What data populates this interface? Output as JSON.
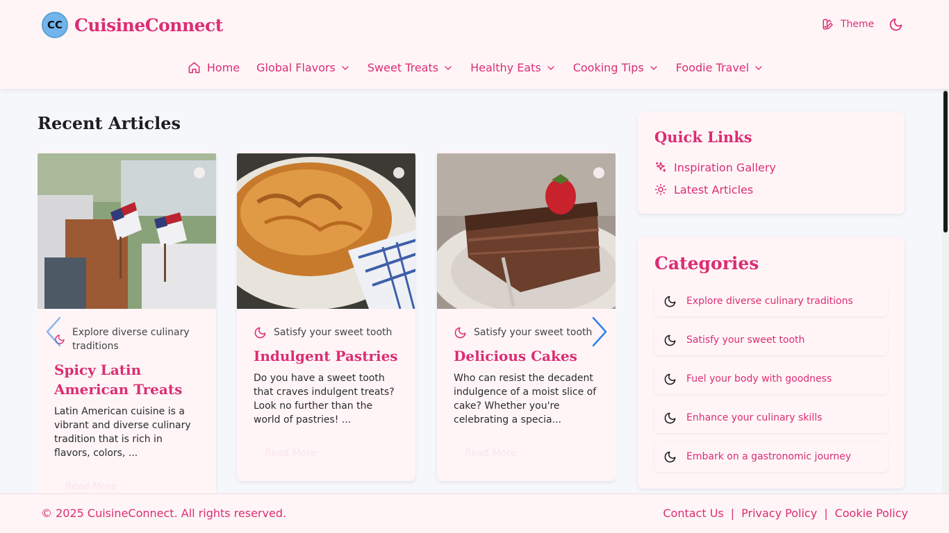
{
  "brand": {
    "initials": "CC",
    "name": "CuisineConnect"
  },
  "header": {
    "theme_label": "Theme",
    "icons": {
      "theme": "palette-icon",
      "mode": "moon-icon"
    }
  },
  "nav": [
    {
      "label": "Home",
      "icon": "home-icon"
    },
    {
      "label": "Global Flavors",
      "icon": "chevron-down-icon"
    },
    {
      "label": "Sweet Treats",
      "icon": "chevron-down-icon"
    },
    {
      "label": "Healthy Eats",
      "icon": "chevron-down-icon"
    },
    {
      "label": "Cooking Tips",
      "icon": "chevron-down-icon"
    },
    {
      "label": "Foodie Travel",
      "icon": "chevron-down-icon"
    }
  ],
  "recent": {
    "title": "Recent Articles",
    "articles": [
      {
        "category": "Explore diverse culinary traditions",
        "title": "Spicy Latin American Treats",
        "excerpt": "Latin American cuisine is a vibrant and diverse culinary tradition that is rich in flavors, colors, ...",
        "read_more": "Read More"
      },
      {
        "category": "Satisfy your sweet tooth",
        "title": "Indulgent Pastries",
        "excerpt": "Do you have a sweet tooth that craves indulgent treats? Look no further than the world of pastries! ...",
        "read_more": "Read More"
      },
      {
        "category": "Satisfy your sweet tooth",
        "title": "Delicious Cakes",
        "excerpt": "Who can resist the decadent indulgence of a moist slice of cake? Whether you're celebrating a specia...",
        "read_more": "Read More"
      }
    ]
  },
  "quick_links": {
    "title": "Quick Links",
    "items": [
      {
        "label": "Inspiration Gallery",
        "icon": "sparkles-icon"
      },
      {
        "label": "Latest Articles",
        "icon": "sun-icon"
      }
    ]
  },
  "categories": {
    "title": "Categories",
    "items": [
      "Explore diverse culinary traditions",
      "Satisfy your sweet tooth",
      "Fuel your body with goodness",
      "Enhance your culinary skills",
      "Embark on a gastronomic journey"
    ]
  },
  "footer": {
    "copyright": "© 2025 CuisineConnect. All rights reserved.",
    "links": [
      "Contact Us",
      "Privacy Policy",
      "Cookie Policy"
    ],
    "separator": "|"
  },
  "colors": {
    "accent": "#db2d73",
    "surface": "#fff5f7",
    "page_bg": "#f6f7fb",
    "arrow": "#2f80ed"
  }
}
